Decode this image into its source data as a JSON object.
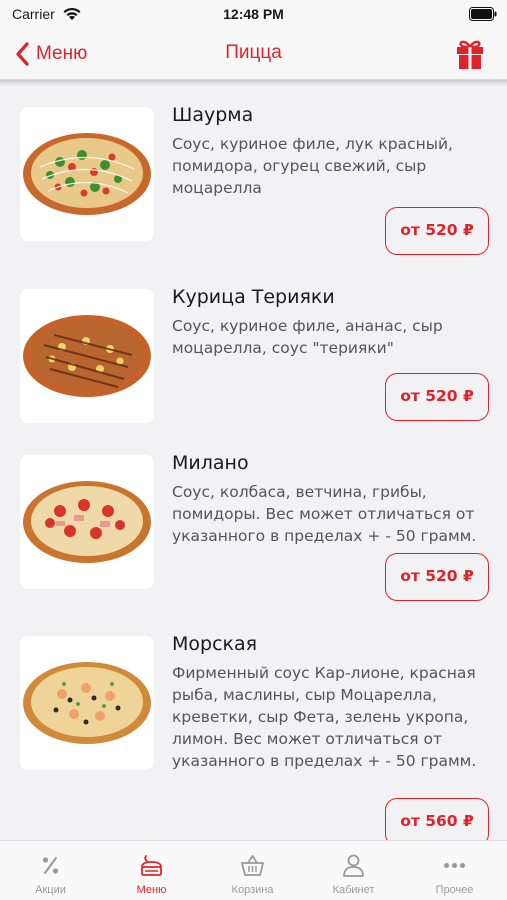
{
  "status_bar": {
    "carrier": "Carrier",
    "time": "12:48 PM"
  },
  "nav": {
    "back_label": "Меню",
    "title": "Пицца"
  },
  "items": [
    {
      "name": "Шаурма",
      "desc": "Соус, куриное филе, лук красный, помидора, огурец свежий, сыр моцарелла",
      "price": "от 520 ₽"
    },
    {
      "name": "Курица Терияки",
      "desc": "Соус, куриное филе, ананас, сыр моцарелла, соус \"терияки\"",
      "price": "от 520 ₽"
    },
    {
      "name": "Милано",
      "desc": "Соус, колбаса, ветчина, грибы, помидоры. Вес может отличаться от указанного в пределах + - 50 грамм.",
      "price": "от 520 ₽"
    },
    {
      "name": "Морская",
      "desc": "Фирменный соус Кар-лионе, красная рыба, маслины, сыр Моцарелла, креветки, сыр Фета, зелень укропа, лимон. Вес может отличаться от указанного в пределах + - 50 грамм.",
      "price": "от 560 ₽"
    }
  ],
  "tabs": [
    {
      "label": "Акции",
      "icon": "percent-icon"
    },
    {
      "label": "Меню",
      "icon": "menu-icon"
    },
    {
      "label": "Корзина",
      "icon": "basket-icon"
    },
    {
      "label": "Кабинет",
      "icon": "person-icon"
    },
    {
      "label": "Прочее",
      "icon": "more-icon"
    }
  ],
  "colors": {
    "accent": "#e0232b",
    "background": "#f2f2f4",
    "tab_inactive": "#999999"
  }
}
